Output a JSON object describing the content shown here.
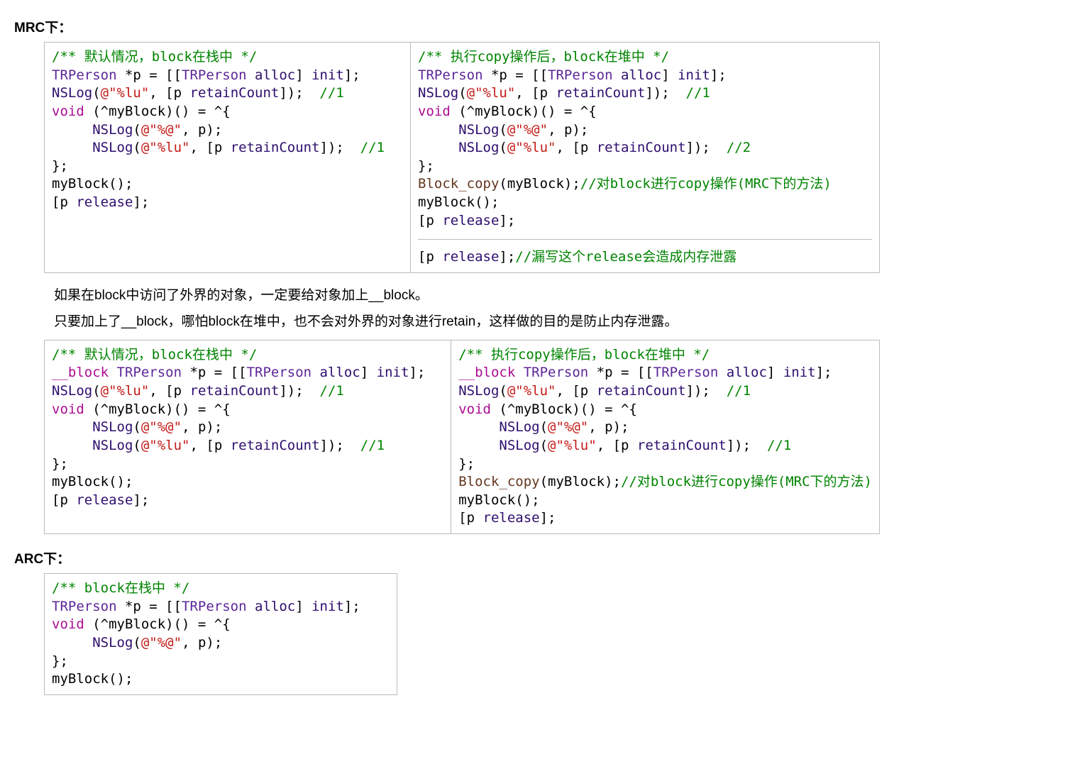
{
  "headings": {
    "mrc": "MRC下：",
    "arc": "ARC下："
  },
  "notes": {
    "line1": "如果在block中访问了外界的对象，一定要给对象加上__block。",
    "line2": "只要加上了__block，哪怕block在堆中，也不会对外界的对象进行retain，这样做的目的是防止内存泄露。"
  },
  "code": {
    "mrc1_left": {
      "comment_head": "/** 默认情况，block在栈中 */",
      "line2_pre": "TRPerson",
      "line2_mid": " *p = [[",
      "line2_type": "TRPerson",
      "line2_aft": " ",
      "line2_alloc": "alloc",
      "line2_end": "] ",
      "line2_init": "init",
      "line2_final": "];",
      "nslog": "NSLog",
      "str_lu": "@\"%lu\"",
      "retainCount": "retainCount",
      "cmt1": "//1",
      "void": "void",
      "block_sig": " (^myBlock)() = ^{",
      "str_at": "@\"%@\"",
      "close_block": "};",
      "call": "myBlock();",
      "release": "release",
      "p_release": "[p ",
      "semi": "];"
    },
    "mrc1_right": {
      "comment_head": "/** 执行copy操作后，block在堆中 */",
      "cmt2": "//2",
      "block_copy": "Block_copy",
      "block_copy_arg": "(myBlock);",
      "block_copy_cmt": "//对block进行copy操作(MRC下的方法)",
      "leak_cmt": "//漏写这个release会造成内存泄露"
    },
    "mrc2": {
      "block_kw": "__block"
    },
    "arc": {
      "comment_head": "/** block在栈中 */"
    }
  }
}
